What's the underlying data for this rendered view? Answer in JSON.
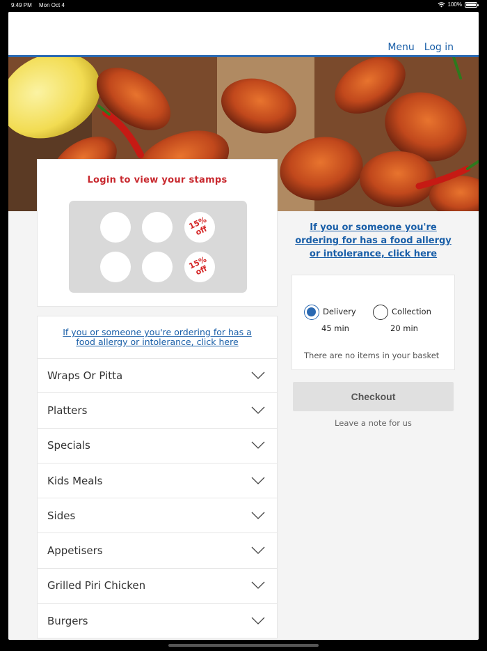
{
  "status_bar": {
    "time": "9:49 PM",
    "date": "Mon Oct 4",
    "battery": "100%"
  },
  "header": {
    "nav": [
      {
        "label": "Menu"
      },
      {
        "label": "Log in"
      }
    ]
  },
  "stamps": {
    "title": "Login to view your stamps",
    "offers": [
      {
        "line1": "15%",
        "line2": "off"
      },
      {
        "line1": "15%",
        "line2": "off"
      }
    ]
  },
  "allergy_notice": {
    "left": "If you or someone you're ordering for has a food allergy or intolerance, click here",
    "right": "If you or someone you're ordering for has a food allergy or intolerance, click here"
  },
  "categories": [
    {
      "label": "Wraps Or Pitta"
    },
    {
      "label": "Platters"
    },
    {
      "label": "Specials"
    },
    {
      "label": "Kids Meals"
    },
    {
      "label": "Sides"
    },
    {
      "label": "Appetisers"
    },
    {
      "label": "Grilled Piri Chicken"
    },
    {
      "label": "Burgers"
    }
  ],
  "order_options": {
    "delivery": {
      "label": "Delivery",
      "time": "45 min",
      "selected": true
    },
    "collection": {
      "label": "Collection",
      "time": "20 min",
      "selected": false
    },
    "basket_empty": "There are no items in your basket"
  },
  "checkout": {
    "label": "Checkout",
    "note_label": "Leave a note for us"
  },
  "colors": {
    "brand_blue": "#2a69b2",
    "stamp_red": "#c8282e",
    "background": "#f4f4f4"
  }
}
